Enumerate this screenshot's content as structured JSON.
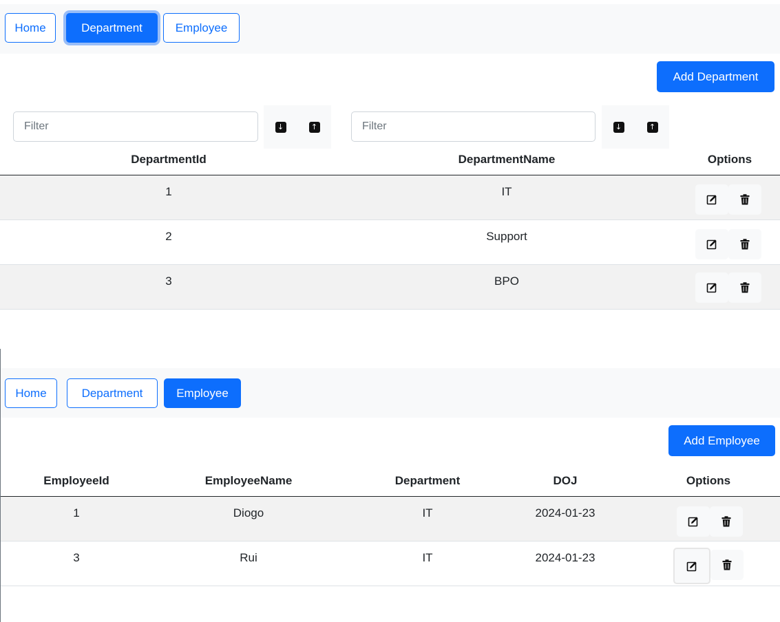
{
  "department_view": {
    "nav": {
      "home": "Home",
      "department": "Department",
      "employee": "Employee"
    },
    "add_button": "Add Department",
    "filters": {
      "id_placeholder": "Filter",
      "name_placeholder": "Filter"
    },
    "sort_icons": {
      "descending": "arrow-down-icon",
      "ascending": "arrow-up-icon"
    },
    "columns": [
      "DepartmentId",
      "DepartmentName",
      "Options"
    ],
    "rows": [
      {
        "id": "1",
        "name": "IT"
      },
      {
        "id": "2",
        "name": "Support"
      },
      {
        "id": "3",
        "name": "BPO"
      }
    ]
  },
  "employee_view": {
    "nav": {
      "home": "Home",
      "department": "Department",
      "employee": "Employee"
    },
    "add_button": "Add Employee",
    "columns": [
      "EmployeeId",
      "EmployeeName",
      "Department",
      "DOJ",
      "Options"
    ],
    "rows": [
      {
        "id": "1",
        "name": "Diogo",
        "department": "IT",
        "doj": "2024-01-23"
      },
      {
        "id": "3",
        "name": "Rui",
        "department": "IT",
        "doj": "2024-01-23"
      }
    ]
  },
  "icons": {
    "edit": "edit-icon",
    "delete": "trash-icon"
  },
  "colors": {
    "primary": "#0d6efd",
    "navbar_bg": "#f8f9fa",
    "striped_row": "#f2f2f2"
  }
}
